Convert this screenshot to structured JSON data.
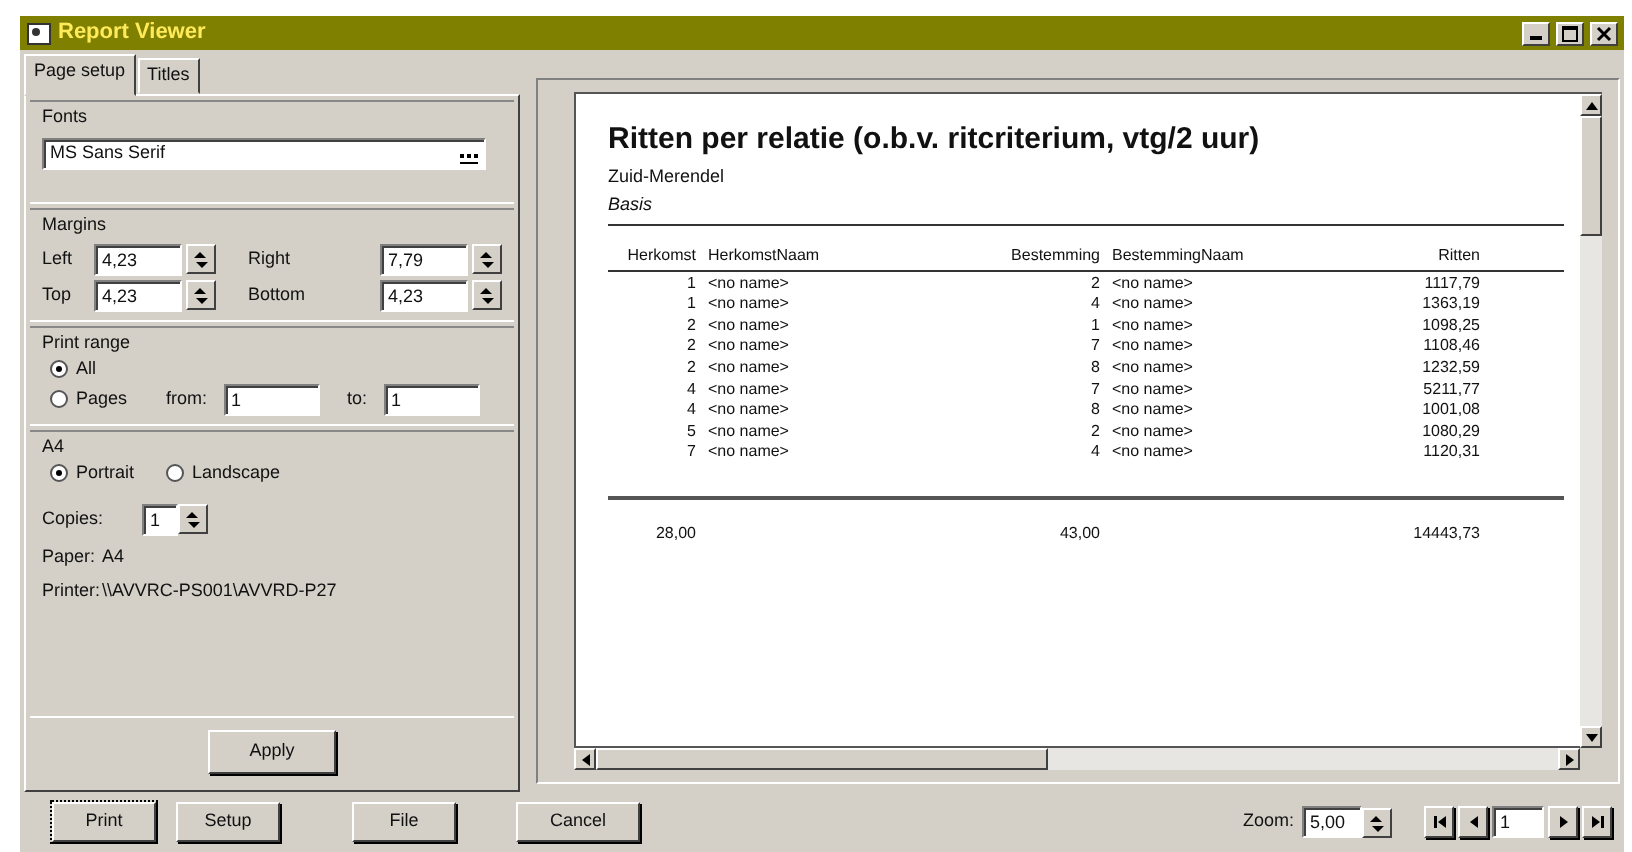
{
  "window": {
    "title": "Report Viewer"
  },
  "tabs": [
    {
      "label": "Page setup",
      "selected": true
    },
    {
      "label": "Titles",
      "selected": false
    }
  ],
  "fonts": {
    "label": "Fonts",
    "value": "MS Sans Serif"
  },
  "margins": {
    "label": "Margins",
    "fields": [
      {
        "label": "Left",
        "value": "4,23"
      },
      {
        "label": "Right",
        "value": "7,79"
      },
      {
        "label": "Top",
        "value": "4,23"
      },
      {
        "label": "Bottom",
        "value": "4,23"
      }
    ]
  },
  "print_range": {
    "label": "Print range",
    "options": [
      {
        "label": "All",
        "selected": true
      },
      {
        "label": "Pages",
        "selected": false
      }
    ],
    "from_label": "from:",
    "from_value": "1",
    "to_label": "to:",
    "to_value": "1"
  },
  "paper": {
    "label": "A4",
    "orientations": [
      {
        "label": "Portrait",
        "selected": true
      },
      {
        "label": "Landscape",
        "selected": false
      }
    ],
    "copies_label": "Copies:",
    "copies_value": "1",
    "paper_label": "Paper:",
    "paper_value": "A4",
    "printer_label": "Printer:",
    "printer_value": "\\\\AVVRC-PS001\\AVVRD-P27"
  },
  "apply_button": "Apply",
  "report": {
    "title": "Ritten per relatie (o.b.v. ritcriterium, vtg/2 uur)",
    "subtitle": "Zuid-Merendel",
    "subtitle_2": "Basis",
    "columns": [
      "Herkomst",
      "HerkomstNaam",
      "Bestemming",
      "BestemmingNaam",
      "Ritten"
    ],
    "rows": [
      [
        "1",
        "<no name>",
        "2",
        "<no name>",
        "1117,79"
      ],
      [
        "1",
        "<no name>",
        "4",
        "<no name>",
        "1363,19"
      ],
      [
        "2",
        "<no name>",
        "1",
        "<no name>",
        "1098,25"
      ],
      [
        "2",
        "<no name>",
        "7",
        "<no name>",
        "1108,46"
      ],
      [
        "2",
        "<no name>",
        "8",
        "<no name>",
        "1232,59"
      ],
      [
        "4",
        "<no name>",
        "7",
        "<no name>",
        "5211,77"
      ],
      [
        "4",
        "<no name>",
        "8",
        "<no name>",
        "1001,08"
      ],
      [
        "5",
        "<no name>",
        "2",
        "<no name>",
        "1080,29"
      ],
      [
        "7",
        "<no name>",
        "4",
        "<no name>",
        "1120,31"
      ]
    ],
    "totals": {
      "herkomst": "28,00",
      "bestemming": "43,00",
      "ritten": "14443,73"
    }
  },
  "bottom_buttons": [
    "Print",
    "Setup",
    "File",
    "Cancel"
  ],
  "zoom": {
    "label": "Zoom:",
    "value": "5,00"
  },
  "page_nav": {
    "value": "1"
  }
}
